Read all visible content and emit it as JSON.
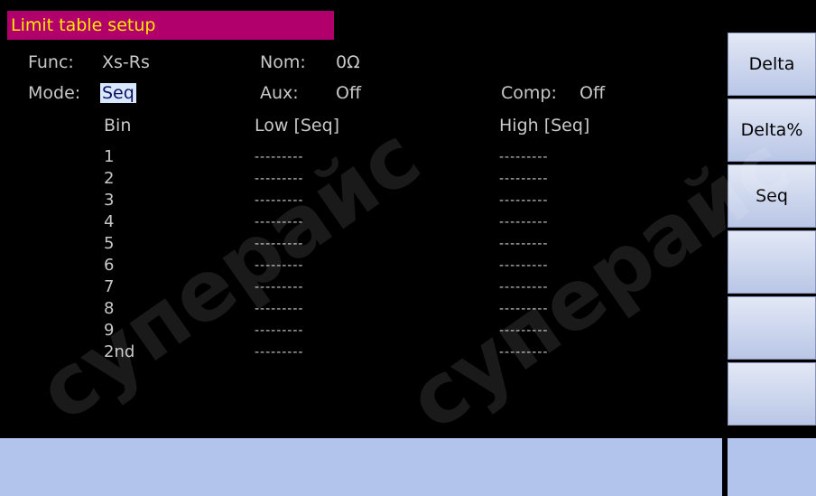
{
  "screen": {
    "title": "Limit table setup"
  },
  "fields": {
    "func_label": "Func:",
    "func_value": "Xs-Rs",
    "nom_label": "Nom:",
    "nom_value": "0Ω",
    "mode_label": "Mode:",
    "mode_value": "Seq",
    "aux_label": "Aux:",
    "aux_value": "Off",
    "comp_label": "Comp:",
    "comp_value": "Off"
  },
  "table": {
    "headers": {
      "bin": "Bin",
      "low": "Low [Seq]",
      "high": "High [Seq]"
    },
    "rows": [
      {
        "bin": "1",
        "low": "---------",
        "high": "---------"
      },
      {
        "bin": "2",
        "low": "---------",
        "high": "---------"
      },
      {
        "bin": "3",
        "low": "---------",
        "high": "---------"
      },
      {
        "bin": "4",
        "low": "---------",
        "high": "---------"
      },
      {
        "bin": "5",
        "low": "---------",
        "high": "---------"
      },
      {
        "bin": "6",
        "low": "---------",
        "high": "---------"
      },
      {
        "bin": "7",
        "low": "---------",
        "high": "---------"
      },
      {
        "bin": "8",
        "low": "---------",
        "high": "---------"
      },
      {
        "bin": "9",
        "low": "---------",
        "high": "---------"
      },
      {
        "bin": "2nd",
        "low": "---------",
        "high": "---------"
      }
    ]
  },
  "softkeys": [
    {
      "label": "Delta"
    },
    {
      "label": "Delta%"
    },
    {
      "label": "Seq"
    },
    {
      "label": ""
    },
    {
      "label": ""
    },
    {
      "label": ""
    }
  ],
  "watermark": "суперайс",
  "colors": {
    "title_bg": "#b1006b",
    "title_fg": "#ffe800",
    "status_bar": "#b2c4ec",
    "selected_bg": "#d8e8ff"
  }
}
